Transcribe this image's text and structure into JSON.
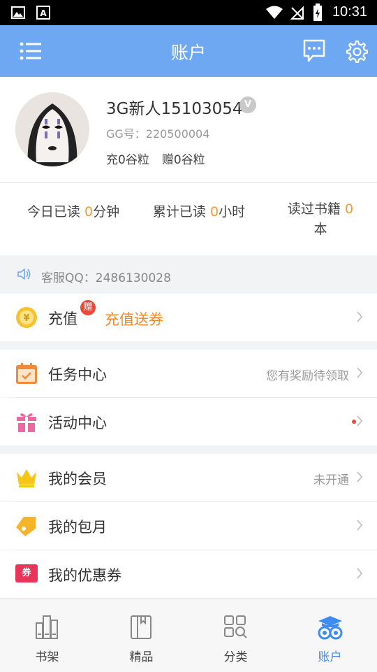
{
  "status_bar": {
    "time": "10:31"
  },
  "header": {
    "title": "账户"
  },
  "profile": {
    "username": "3G新人15103054",
    "vip_badge": "V",
    "gg_id": "GG号：220500004",
    "charged": "充0谷粒",
    "gifted": "赠0谷粒"
  },
  "stats": {
    "today_prefix": "今日已读 ",
    "today_value": "0",
    "today_suffix": "分钟",
    "total_prefix": "累计已读 ",
    "total_value": "0",
    "total_suffix": "小时",
    "books_prefix": "读过书籍 ",
    "books_value": "0",
    "books_suffix": "本"
  },
  "notice": {
    "text": "客服QQ：2486130028"
  },
  "recharge": {
    "label": "充值",
    "badge": "赠",
    "promo": "充值送券"
  },
  "menu": {
    "tasks": {
      "label": "任务中心",
      "right": "您有奖励待领取"
    },
    "activity": {
      "label": "活动中心"
    },
    "vip": {
      "label": "我的会员",
      "right": "未开通"
    },
    "monthly": {
      "label": "我的包月"
    },
    "coupons": {
      "label": "我的优惠券",
      "icon_text": "券"
    }
  },
  "tabs": [
    {
      "label": "书架"
    },
    {
      "label": "精品"
    },
    {
      "label": "分类"
    },
    {
      "label": "账户"
    }
  ],
  "colors": {
    "header": "#6ea8f2",
    "accent": "#f39a3a",
    "active_tab": "#3f8cf0"
  }
}
